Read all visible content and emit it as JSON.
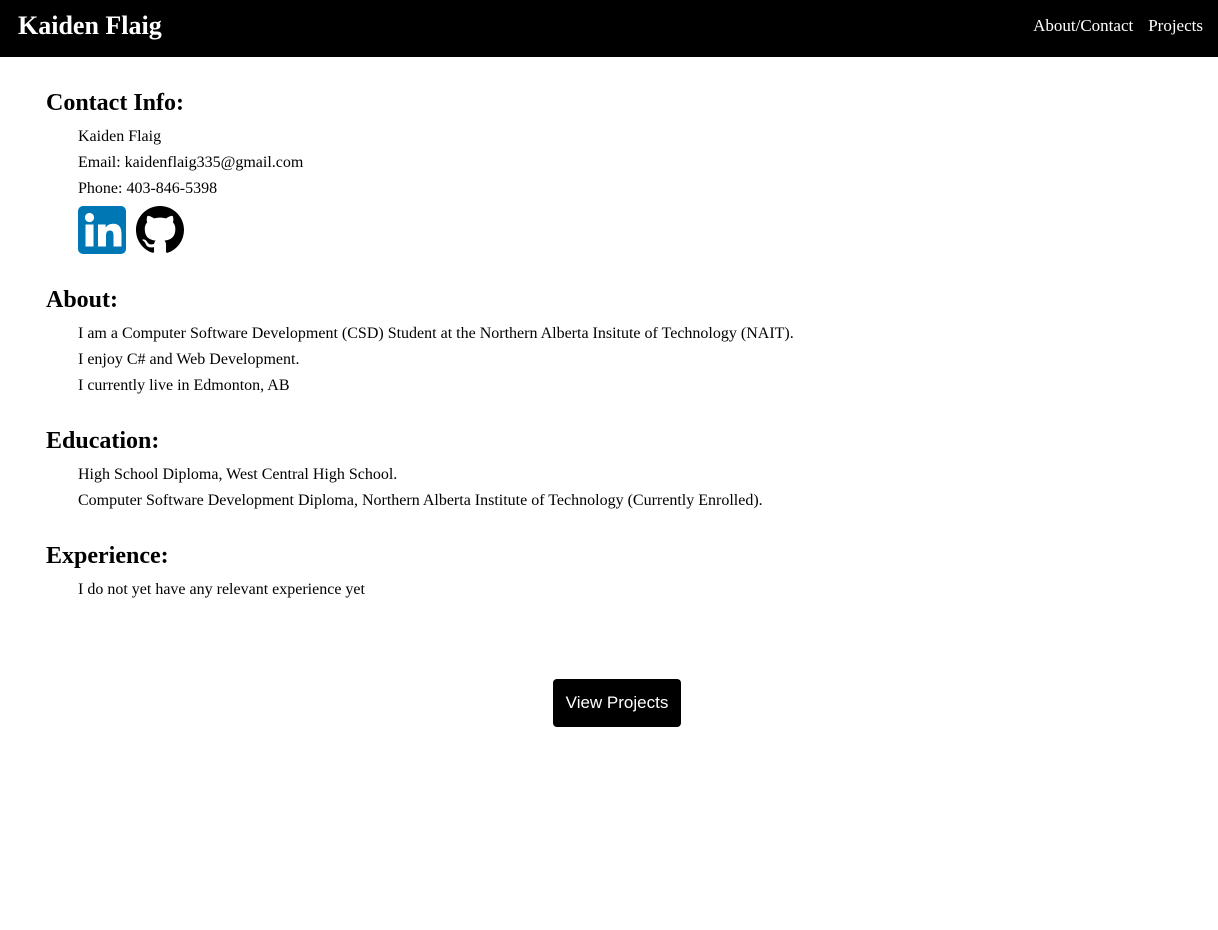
{
  "header": {
    "title": "Kaiden Flaig",
    "nav": [
      {
        "label": "About/Contact"
      },
      {
        "label": "Projects"
      }
    ]
  },
  "contact": {
    "heading": "Contact Info:",
    "name": "Kaiden Flaig",
    "email": "Email: kaidenflaig335@gmail.com",
    "phone": "Phone: 403-846-5398",
    "social": [
      {
        "icon": "linkedin-icon",
        "color": "#0077B5"
      },
      {
        "icon": "github-icon",
        "color": "#000000"
      }
    ]
  },
  "about": {
    "heading": "About:",
    "lines": [
      "I am a Computer Software Development (CSD) Student at the Northern Alberta Insitute of Technology (NAIT).",
      "I enjoy C# and Web Development.",
      "I currently live in Edmonton, AB"
    ]
  },
  "education": {
    "heading": "Education:",
    "lines": [
      "High School Diploma, West Central High School.",
      "Computer Software Development Diploma, Northern Alberta Institute of Technology (Currently Enrolled)."
    ]
  },
  "experience": {
    "heading": "Experience:",
    "lines": [
      "I do not yet have any relevant experience yet"
    ]
  },
  "cta": {
    "label": "View Projects"
  }
}
